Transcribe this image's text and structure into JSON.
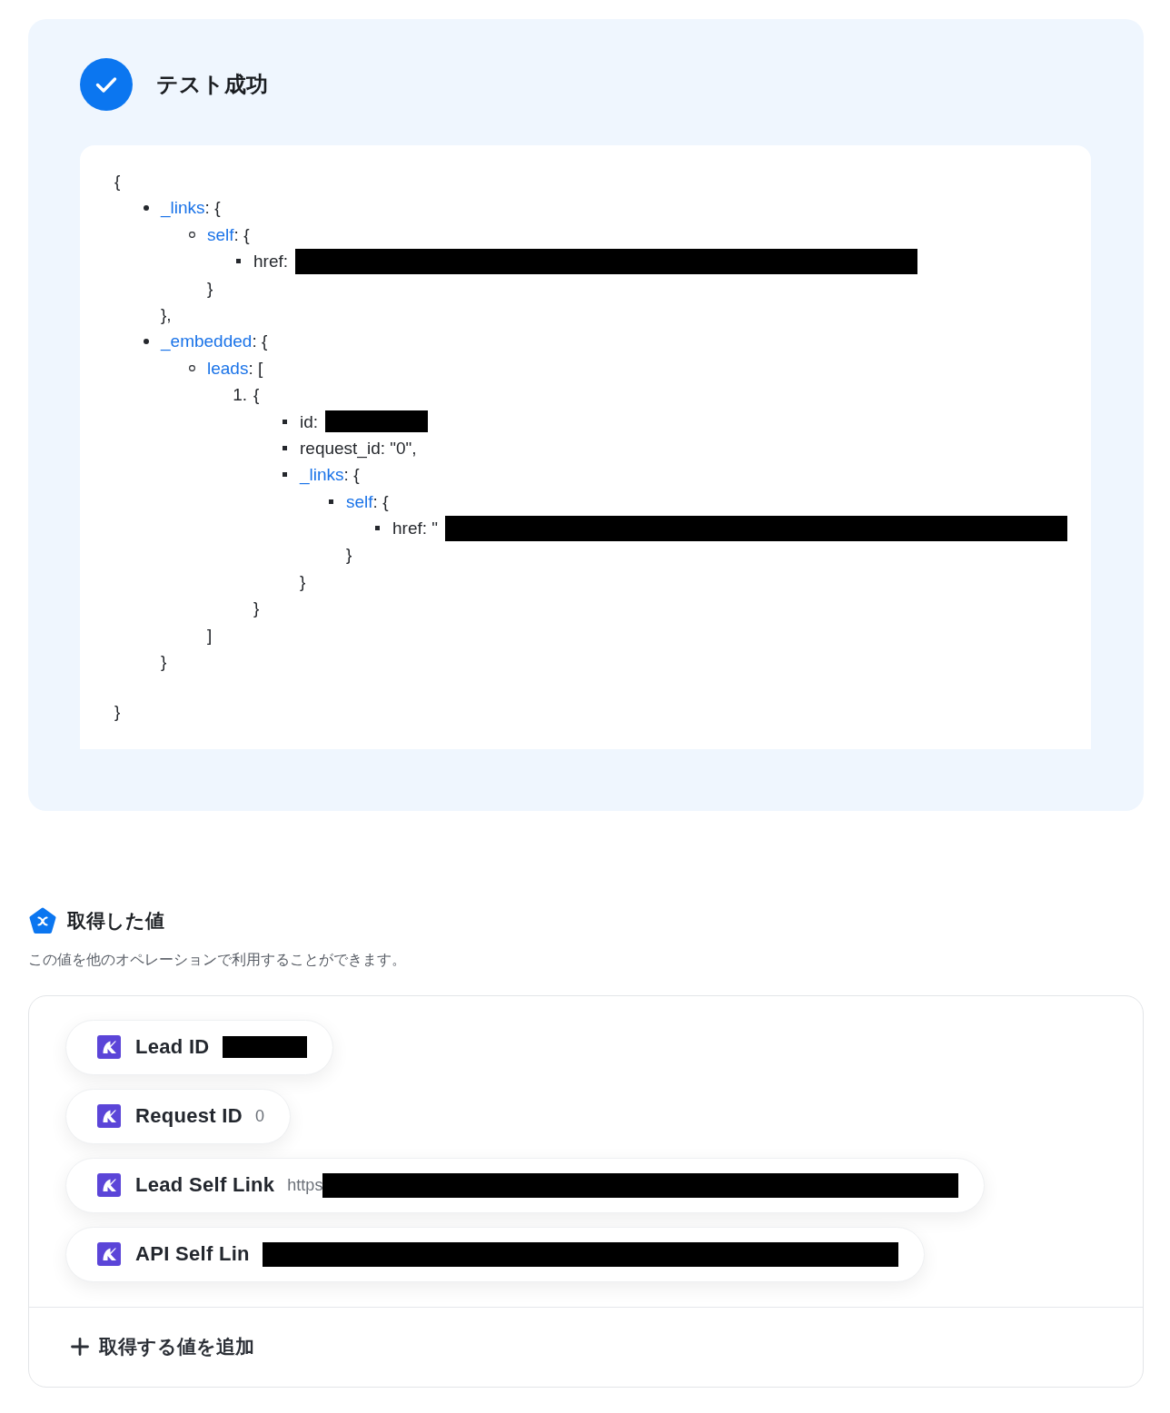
{
  "test_result": {
    "success": true,
    "title": "テスト成功",
    "response": {
      "open": "{",
      "close": "}",
      "items": [
        {
          "kind": "bullet",
          "key": "_links",
          "linked": true,
          "after": ": {",
          "close": "},",
          "children": [
            {
              "kind": "bullet",
              "key": "self",
              "linked": true,
              "after": ": {",
              "close": "}",
              "children": [
                {
                  "kind": "bullet",
                  "key": "href",
                  "linked": false,
                  "after": ":",
                  "redaction": {
                    "kind": "long"
                  }
                }
              ]
            }
          ]
        },
        {
          "kind": "bullet",
          "key": "_embedded",
          "linked": true,
          "after": ": {",
          "close": "}",
          "children": [
            {
              "kind": "bullet",
              "key": "leads",
              "linked": true,
              "after": ": [",
              "close": "]",
              "children": [
                {
                  "kind": "numbered",
                  "marker": "1.",
                  "text": "{",
                  "close": "}",
                  "children": [
                    {
                      "kind": "bullet",
                      "key": "id",
                      "linked": false,
                      "after": ":",
                      "redaction": {
                        "kind": "short"
                      }
                    },
                    {
                      "kind": "bullet",
                      "key": "request_id",
                      "linked": false,
                      "after": ": \"0\","
                    },
                    {
                      "kind": "bullet",
                      "key": "_links",
                      "linked": true,
                      "after": ": {",
                      "close": "}",
                      "children": [
                        {
                          "kind": "bullet",
                          "key": "self",
                          "linked": true,
                          "after": ": {",
                          "close": "}",
                          "children": [
                            {
                              "kind": "bullet",
                              "key": "href",
                              "linked": false,
                              "after": ": \"",
                              "redaction": {
                                "kind": "long"
                              }
                            }
                          ]
                        }
                      ]
                    }
                  ]
                }
              ]
            }
          ]
        }
      ]
    }
  },
  "fetched_values": {
    "title": "取得した値",
    "description": "この値を他のオペレーションで利用することができます。",
    "items": [
      {
        "label": "Lead ID",
        "redaction": {
          "kind": "short"
        }
      },
      {
        "label": "Request ID",
        "value": "0"
      },
      {
        "label": "Lead Self Link",
        "value": "https",
        "redaction": {
          "kind": "long"
        }
      },
      {
        "label": "API Self Lin",
        "redaction": {
          "kind": "long"
        }
      }
    ],
    "add_button": {
      "label": "取得する値を追加"
    }
  }
}
